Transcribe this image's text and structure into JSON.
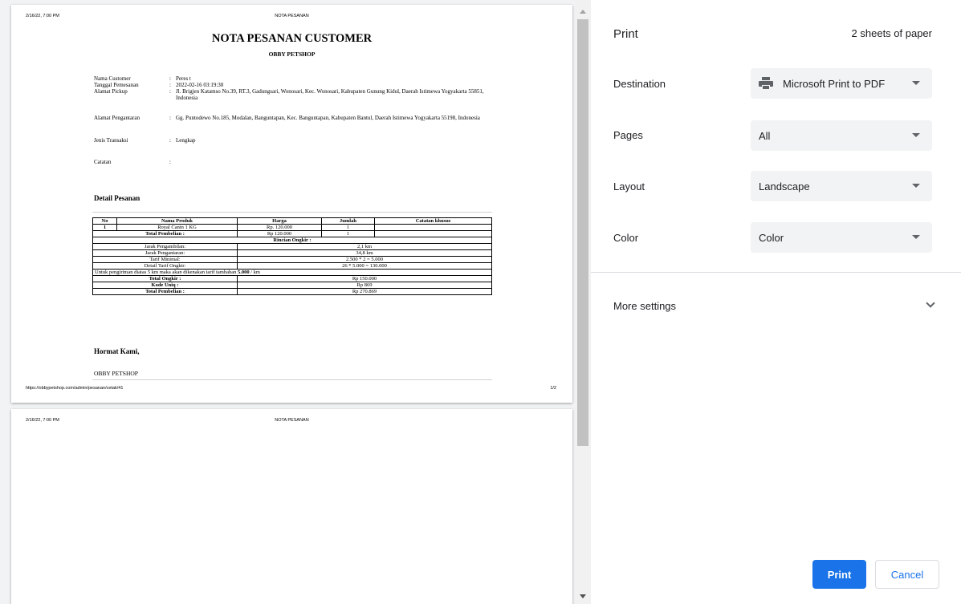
{
  "preview": {
    "header_date": "2/16/22, 7:00 PM",
    "header_title": "NOTA PESANAN",
    "footer_url": "https://obbypetshop.com/admin/pesanan/cetak/41",
    "footer_page": "1/2",
    "doc_title": "NOTA PESANAN CUSTOMER",
    "doc_subtitle": "OBBY PETSHOP",
    "info": [
      {
        "label": "Nama Customer",
        "value": "Peres t"
      },
      {
        "label": "Tanggal Pemesanan",
        "value": "2022-02-16 03:19:30"
      },
      {
        "label": "Alamat Pickup",
        "value": "Jl. Brigjen Katamso No.39, RT.3, Gadungsari, Wonosari, Kec. Wonosari, Kabupaten Gunung Kidul, Daerah Istimewa Yogyakarta 55851, Indonesia"
      },
      {
        "label": "Alamat Pengantaran",
        "value": "Gg. Puntodewo No.185, Modalan, Banguntapan, Kec. Banguntapan, Kabupaten Bantul, Daerah Istimewa Yogyakarta 55198, Indonesia"
      },
      {
        "label": "Jenis Transaksi",
        "value": "Lengkap"
      },
      {
        "label": "Catatan",
        "value": ""
      }
    ],
    "colon": ":",
    "section_title": "Detail Pesanan",
    "table": {
      "headers": [
        "No",
        "Nama Produk",
        "Harga",
        "Jumlah",
        "Catatan khusus"
      ],
      "item": {
        "no": "1",
        "name": "Royal Canin 1 KG",
        "price": "Rp. 120.000",
        "qty": "1",
        "note": ""
      },
      "total_label": "Total Pembelian :",
      "total_price": "Rp 120.000",
      "total_qty": "1",
      "rincian": "Rincian Ongkir :",
      "ongkir_rows": [
        {
          "label": "Jarak Pengambilan:",
          "value": "2,1 km"
        },
        {
          "label": "Jarak Pengantaran:",
          "value": "34,8 km"
        },
        {
          "label": "Tarif Minimal:",
          "value": "2.500 * 2 = 5.000"
        },
        {
          "label": "Detail Tarif Ongkir:",
          "value": "26 * 5.000 = 130.000"
        }
      ],
      "note_prefix": "Untuk pengiriman diatas 5 km maka akan dikenakan tarif tambahan ",
      "note_bold": "5.000",
      "note_suffix": " / km",
      "summary": [
        {
          "label": "Total Ongkir :",
          "value": "Rp 150.000"
        },
        {
          "label": "Kode Uniq :",
          "value": "Rp 869"
        },
        {
          "label": "Total Pembelian :",
          "value": "Rp 270.869"
        }
      ]
    },
    "hormat": "Hormat Kami,",
    "signature": "OBBY PETSHOP",
    "page2_header_date": "2/16/22, 7:00 PM",
    "page2_header_title": "NOTA PESANAN"
  },
  "panel": {
    "title": "Print",
    "sheets": "2 sheets of paper",
    "destination_label": "Destination",
    "destination_value": "Microsoft Print to PDF",
    "pages_label": "Pages",
    "pages_value": "All",
    "layout_label": "Layout",
    "layout_value": "Landscape",
    "color_label": "Color",
    "color_value": "Color",
    "more_settings": "More settings",
    "print_button": "Print",
    "cancel_button": "Cancel"
  },
  "colors": {
    "accent": "#1a73e8",
    "select_bg": "#f1f3f4",
    "preview_bg": "#f1f3f4"
  }
}
